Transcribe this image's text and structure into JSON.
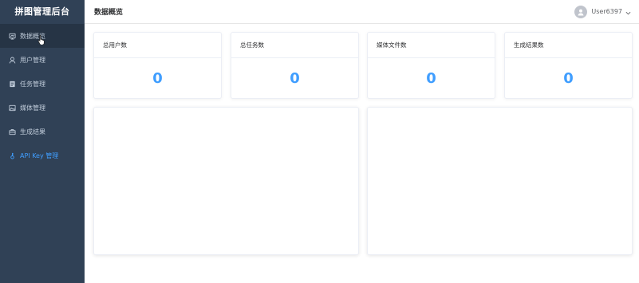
{
  "app_title": "拼图管理后台",
  "sidebar": {
    "items": [
      {
        "label": "数据概览",
        "icon": "dashboard-icon"
      },
      {
        "label": "用户管理",
        "icon": "user-icon"
      },
      {
        "label": "任务管理",
        "icon": "task-icon"
      },
      {
        "label": "媒体管理",
        "icon": "image-icon"
      },
      {
        "label": "生成结果",
        "icon": "briefcase-icon"
      },
      {
        "label": "API Key 管理",
        "icon": "key-icon"
      }
    ]
  },
  "header": {
    "title": "数据概览",
    "username": "User6397"
  },
  "stats": [
    {
      "label": "总用户数",
      "value": "0"
    },
    {
      "label": "总任务数",
      "value": "0"
    },
    {
      "label": "媒体文件数",
      "value": "0"
    },
    {
      "label": "生成结果数",
      "value": "0"
    }
  ],
  "colors": {
    "sidebar_bg": "#304156",
    "active_bg": "#263445",
    "accent": "#409eff",
    "menu_text": "#bfcbd9"
  }
}
